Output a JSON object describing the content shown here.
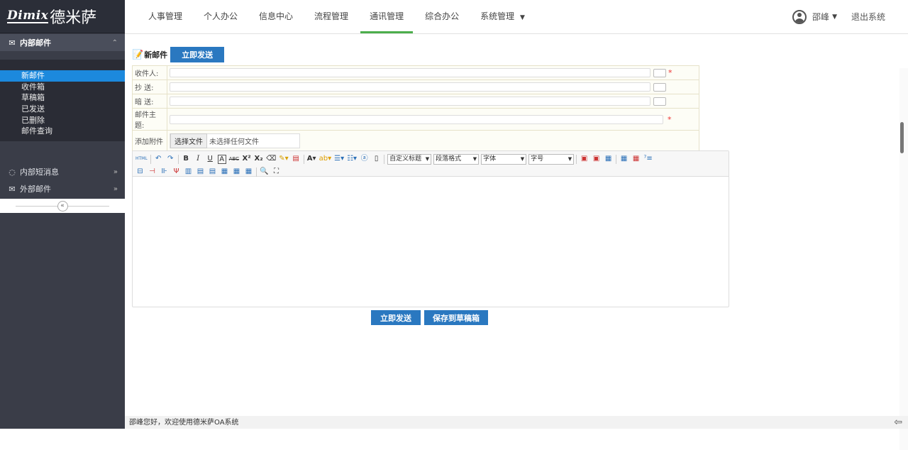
{
  "logo": {
    "latin": "Dimix",
    "cn": "德米萨"
  },
  "top_nav": [
    "人事管理",
    "个人办公",
    "信息中心",
    "流程管理",
    "通讯管理",
    "综合办公",
    "系统管理"
  ],
  "top_nav_active": 4,
  "user": {
    "name": "邵峰",
    "logout": "退出系统"
  },
  "sidebar": {
    "sections": [
      {
        "label": "内部邮件",
        "icon": "envelope-icon",
        "expanded": true
      },
      {
        "label": "内部短消息",
        "icon": "chat-icon",
        "expanded": false
      },
      {
        "label": "外部邮件",
        "icon": "mail-icon",
        "expanded": false
      }
    ],
    "items": [
      "新邮件",
      "收件箱",
      "草稿箱",
      "已发送",
      "已删除",
      "邮件查询"
    ],
    "active_item": 0,
    "collapse_glyph": "«"
  },
  "compose": {
    "title": "新邮件",
    "send_label": "立即发送",
    "fields": {
      "to": "收件人:",
      "cc": "抄 送:",
      "bcc": "暗 送:",
      "subject": "邮件主题:",
      "attach": "添加附件"
    },
    "required_mark": "*",
    "file_button": "选择文件",
    "file_none": "未选择任何文件"
  },
  "editor": {
    "selects": [
      "自定义标题",
      "段落格式",
      "字体",
      "字号"
    ],
    "html_label": "HTML"
  },
  "actions": {
    "send": "立即发送",
    "save_draft": "保存到草稿箱"
  },
  "status": {
    "text": "邵峰您好，欢迎使用德米萨OA系统"
  },
  "colors": {
    "accent": "#2a78c0",
    "sidebar_bg": "#3a3d48",
    "active_item": "#1c89dd",
    "tab_active": "#4cae4c"
  }
}
